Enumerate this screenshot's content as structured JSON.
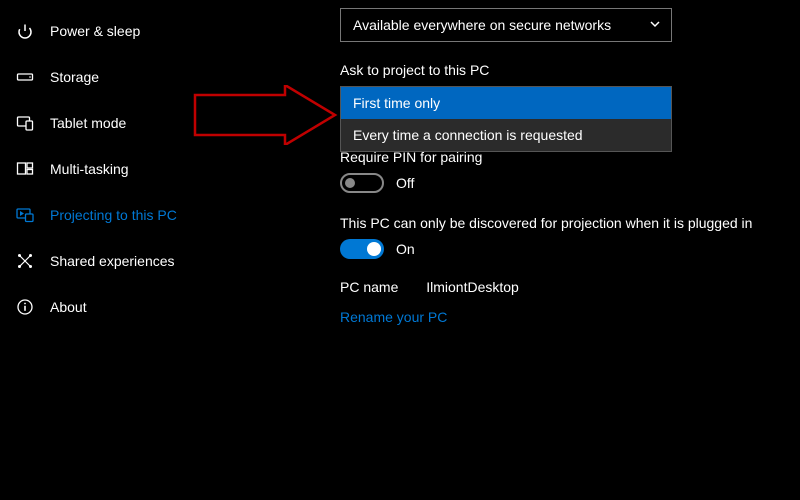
{
  "sidebar": {
    "items": [
      {
        "label": "Power & sleep"
      },
      {
        "label": "Storage"
      },
      {
        "label": "Tablet mode"
      },
      {
        "label": "Multi-tasking"
      },
      {
        "label": "Projecting to this PC"
      },
      {
        "label": "Shared experiences"
      },
      {
        "label": "About"
      }
    ]
  },
  "content": {
    "availability_dropdown": {
      "selected": "Available everywhere on secure networks"
    },
    "ask_label": "Ask to project to this PC",
    "ask_dropdown": {
      "options": [
        {
          "label": "First time only"
        },
        {
          "label": "Every time a connection is requested"
        }
      ]
    },
    "pin_label": "Require PIN for pairing",
    "pin_toggle": {
      "state": "Off"
    },
    "discover_text": "This PC can only be discovered for projection when it is plugged in",
    "discover_toggle": {
      "state": "On"
    },
    "pcname_label": "PC name",
    "pcname_value": "IlmiontDesktop",
    "rename_link": "Rename your PC"
  }
}
